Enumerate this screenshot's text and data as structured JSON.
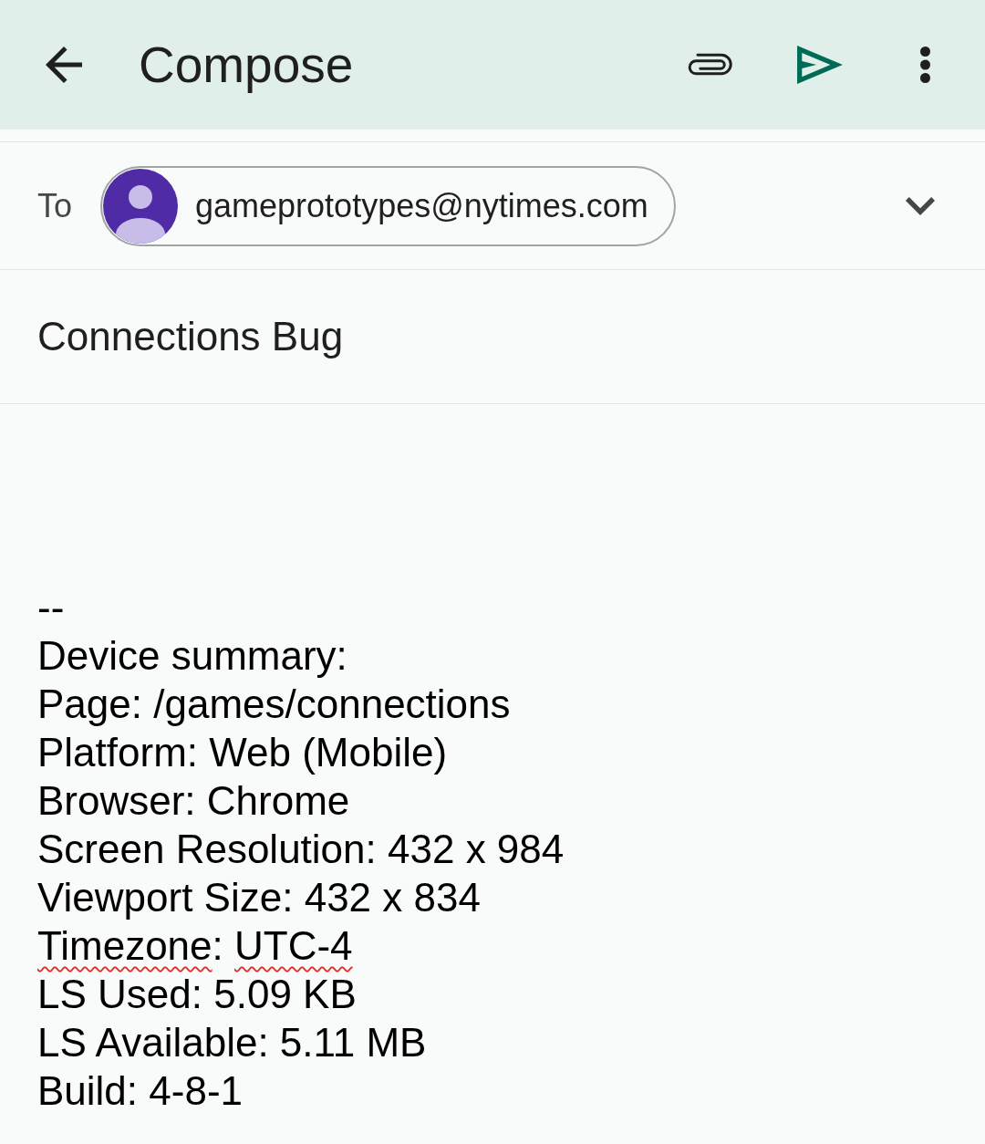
{
  "app_bar": {
    "title": "Compose"
  },
  "to_field": {
    "label": "To",
    "recipients": [
      {
        "address": "gameprototypes@nytimes.com"
      }
    ]
  },
  "subject": {
    "value": "Connections Bug"
  },
  "body": {
    "lines": [
      {
        "parts": [
          {
            "text": "--",
            "misspelled": false
          }
        ]
      },
      {
        "parts": [
          {
            "text": "Device summary:",
            "misspelled": false
          }
        ]
      },
      {
        "parts": [
          {
            "text": "Page: /games/connections",
            "misspelled": false
          }
        ]
      },
      {
        "parts": [
          {
            "text": "Platform: Web (Mobile)",
            "misspelled": false
          }
        ]
      },
      {
        "parts": [
          {
            "text": "Browser: Chrome",
            "misspelled": false
          }
        ]
      },
      {
        "parts": [
          {
            "text": "Screen Resolution: 432 x 984",
            "misspelled": false
          }
        ]
      },
      {
        "parts": [
          {
            "text": "Viewport Size: 432 x 834",
            "misspelled": false
          }
        ]
      },
      {
        "parts": [
          {
            "text": "Timezone",
            "misspelled": true
          },
          {
            "text": ": ",
            "misspelled": false
          },
          {
            "text": "UTC-4",
            "misspelled": true
          }
        ]
      },
      {
        "parts": [
          {
            "text": "LS Used: 5.09 KB",
            "misspelled": false
          }
        ]
      },
      {
        "parts": [
          {
            "text": "LS Available: 5.11 MB",
            "misspelled": false
          }
        ]
      },
      {
        "parts": [
          {
            "text": "Build: 4-8-1",
            "misspelled": false
          }
        ]
      }
    ]
  }
}
